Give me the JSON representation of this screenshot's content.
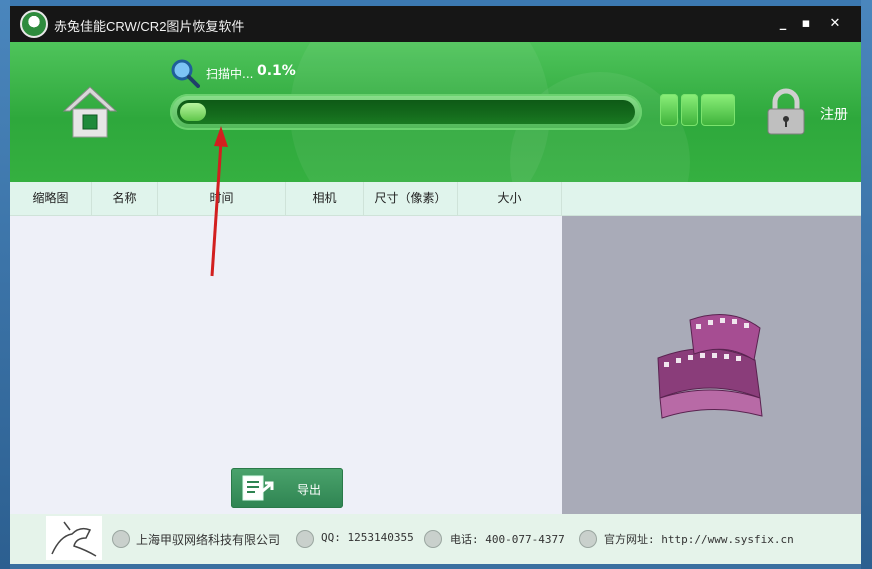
{
  "window": {
    "title": "赤兔佳能CRW/CR2图片恢复软件",
    "controls": [
      "minimize",
      "maximize",
      "close"
    ]
  },
  "header": {
    "scan_label": "扫描中...",
    "scan_percent": "0.1%",
    "progress_fraction": 0.001,
    "register_label": "注册",
    "colors": {
      "accent": "#2ea83c",
      "progress_track": "#0e5a16"
    }
  },
  "columns": [
    "缩略图",
    "名称",
    "时间",
    "相机",
    "尺寸（像素）",
    "大小"
  ],
  "export_label": "导出",
  "footer": {
    "company": "上海甲驭网络科技有限公司",
    "qq": "QQ: 1253140355",
    "phone": "电话: 400-077-4377",
    "website": "官方网址: http://www.sysfix.cn"
  },
  "icons": {
    "home": "home-icon",
    "scan": "magnifier-icon",
    "lock": "lock-icon",
    "film": "film-reel-icon",
    "export": "export-icon"
  }
}
